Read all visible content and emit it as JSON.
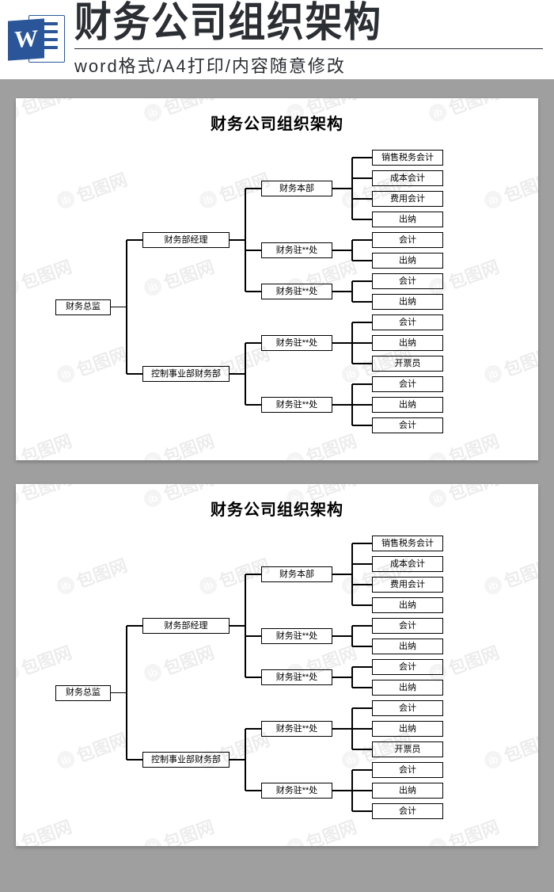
{
  "header": {
    "badge_letter": "W",
    "title": "财务公司组织架构",
    "subtitle": "word格式/A4打印/内容随意修改"
  },
  "watermark": {
    "text": "包图网",
    "glyph": "ib"
  },
  "chart_data": {
    "type": "tree",
    "title": "财务公司组织架构",
    "root": {
      "label": "财务总监",
      "children": [
        {
          "label": "财务部经理",
          "children": [
            {
              "label": "财务本部",
              "children": [
                {
                  "label": "销售税务会计"
                },
                {
                  "label": "成本会计"
                },
                {
                  "label": "费用会计"
                },
                {
                  "label": "出纳"
                }
              ]
            },
            {
              "label": "财务驻**处",
              "children": [
                {
                  "label": "会计"
                },
                {
                  "label": "出纳"
                }
              ]
            },
            {
              "label": "财务驻**处",
              "children": [
                {
                  "label": "会计"
                },
                {
                  "label": "出纳"
                }
              ]
            }
          ]
        },
        {
          "label": "控制事业部财务部",
          "children": [
            {
              "label": "财务驻**处",
              "children": [
                {
                  "label": "会计"
                },
                {
                  "label": "出纳"
                },
                {
                  "label": "开票员"
                }
              ]
            },
            {
              "label": "财务驻**处",
              "children": [
                {
                  "label": "会计"
                },
                {
                  "label": "出纳"
                },
                {
                  "label": "会计"
                }
              ]
            }
          ]
        }
      ]
    }
  }
}
